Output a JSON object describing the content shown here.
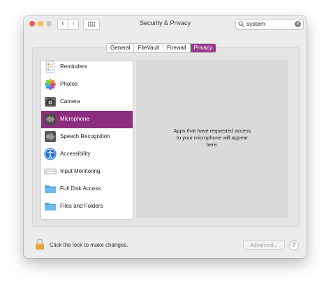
{
  "window": {
    "title": "Security & Privacy",
    "search": {
      "value": "system"
    }
  },
  "nav": {
    "back": "‹",
    "forward": "›"
  },
  "tabs": [
    {
      "label": "General"
    },
    {
      "label": "FileVault"
    },
    {
      "label": "Firewall"
    },
    {
      "label": "Privacy",
      "active": true
    }
  ],
  "sidebar": {
    "items": [
      {
        "label": "Reminders",
        "icon": "reminders-icon"
      },
      {
        "label": "Photos",
        "icon": "photos-icon"
      },
      {
        "label": "Camera",
        "icon": "camera-icon"
      },
      {
        "label": "Microphone",
        "icon": "microphone-icon",
        "selected": true
      },
      {
        "label": "Speech Recognition",
        "icon": "speech-recognition-icon"
      },
      {
        "label": "Accessibility",
        "icon": "accessibility-icon"
      },
      {
        "label": "Input Monitoring",
        "icon": "keyboard-icon"
      },
      {
        "label": "Full Disk Access",
        "icon": "folder-icon"
      },
      {
        "label": "Files and Folders",
        "icon": "folder-icon"
      }
    ]
  },
  "content": {
    "message_lines": [
      "Apps that have requested access",
      "to your microphone will appear",
      "here."
    ]
  },
  "footer": {
    "lock_text": "Click the lock to make changes.",
    "advanced_label": "Advanced...",
    "help_label": "?"
  },
  "colors": {
    "accent": "#9b3a8f",
    "selected_row": "#8c2f7f"
  }
}
